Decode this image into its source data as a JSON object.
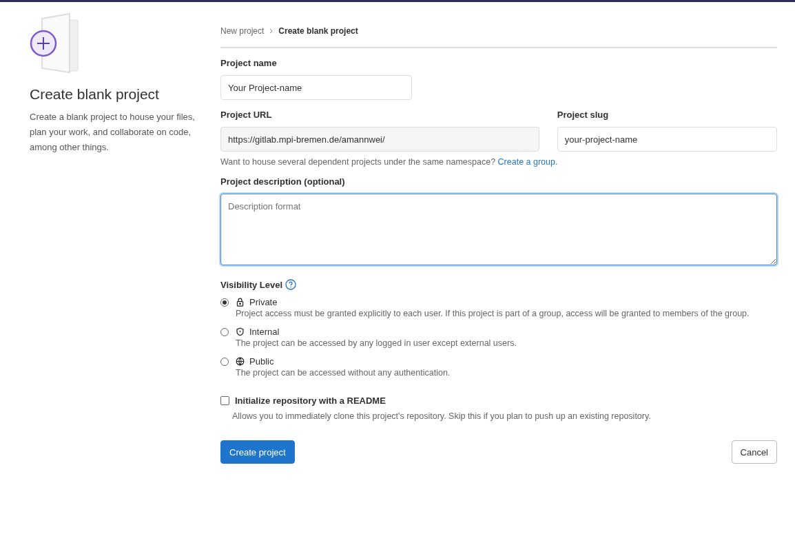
{
  "sidebar": {
    "title": "Create blank project",
    "description": "Create a blank project to house your files, plan your work, and collaborate on code, among other things."
  },
  "breadcrumb": [
    {
      "label": "New project",
      "current": false
    },
    {
      "label": "Create blank project",
      "current": true
    }
  ],
  "project_name": {
    "label": "Project name",
    "value": "Your Project-name"
  },
  "project_url": {
    "label": "Project URL",
    "value": "https://gitlab.mpi-bremen.de/amannwei/"
  },
  "project_slug": {
    "label": "Project slug",
    "value": "your-project-name"
  },
  "namespace_hint": {
    "text": "Want to house several dependent projects under the same namespace?",
    "link": "Create a group."
  },
  "description": {
    "label": "Project description (optional)",
    "placeholder": "Description format",
    "focused": true
  },
  "visibility": {
    "label": "Visibility Level",
    "options": [
      {
        "kind": "lock",
        "label": "Private",
        "description": "Project access must be granted explicitly to each user. If this project is part of a group, access will be granted to members of the group.",
        "selected": true
      },
      {
        "kind": "shield",
        "label": "Internal",
        "description": "The project can be accessed by any logged in user except external users.",
        "selected": false
      },
      {
        "kind": "globe",
        "label": "Public",
        "description": "The project can be accessed without any authentication.",
        "selected": false
      }
    ]
  },
  "readme": {
    "label": "Initialize repository with a README",
    "description": "Allows you to immediately clone this project's repository. Skip this if you plan to push up an existing repository.",
    "checked": false
  },
  "buttons": {
    "create": "Create project",
    "cancel": "Cancel"
  }
}
